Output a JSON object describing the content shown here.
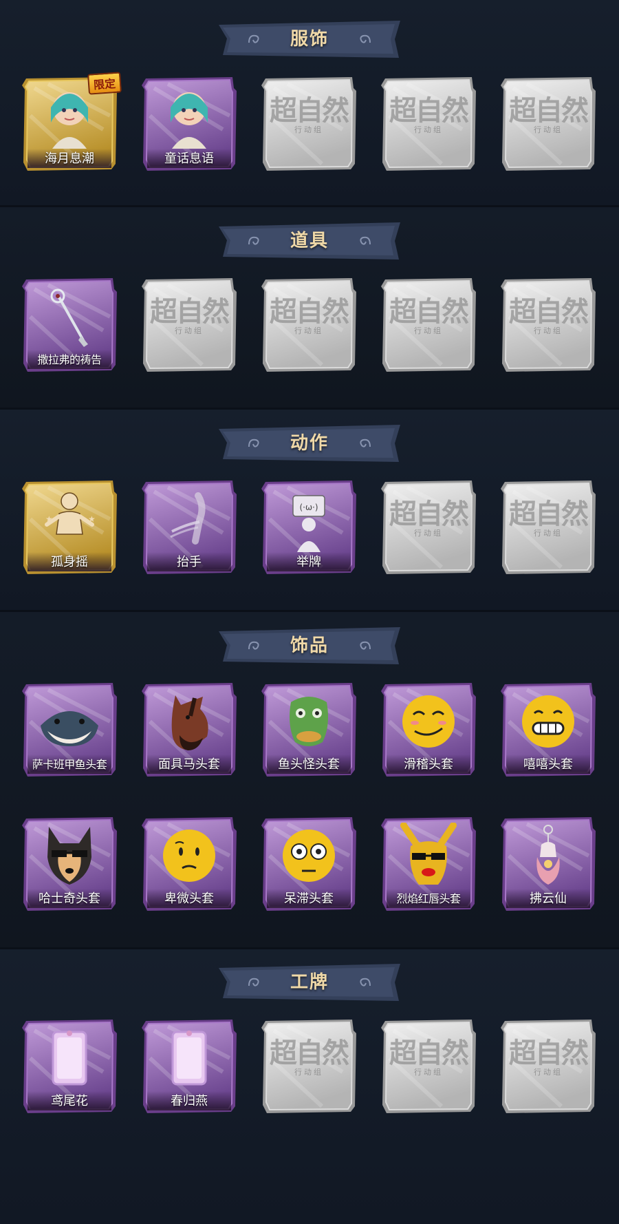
{
  "colors": {
    "background": "#121a26",
    "banner": "#3a4660",
    "title_text": "#f0d9a8",
    "purple_frame": "#8a5aa8",
    "gold_frame": "#d4b048",
    "silver_frame": "#c8c8c8"
  },
  "sections": [
    {
      "title": "服饰",
      "items": [
        {
          "label": "海月息潮",
          "rarity": "gold",
          "badge": "限定",
          "icon": "character-portrait-icon"
        },
        {
          "label": "童话息语",
          "rarity": "purple",
          "icon": "character-portrait-icon"
        },
        {
          "label": "",
          "rarity": "locked",
          "ghost": "超自然",
          "ghost_sub": "行动组"
        },
        {
          "label": "",
          "rarity": "locked",
          "ghost": "超自然",
          "ghost_sub": "行动组"
        },
        {
          "label": "",
          "rarity": "locked",
          "ghost": "超自然",
          "ghost_sub": "行动组"
        }
      ]
    },
    {
      "title": "道具",
      "items": [
        {
          "label": "撒拉弗的祷告",
          "rarity": "purple",
          "icon": "staff-icon"
        },
        {
          "label": "",
          "rarity": "locked",
          "ghost": "超自然",
          "ghost_sub": "行动组"
        },
        {
          "label": "",
          "rarity": "locked",
          "ghost": "超自然",
          "ghost_sub": "行动组"
        },
        {
          "label": "",
          "rarity": "locked",
          "ghost": "超自然",
          "ghost_sub": "行动组"
        },
        {
          "label": "",
          "rarity": "locked",
          "ghost": "超自然",
          "ghost_sub": "行动组"
        }
      ]
    },
    {
      "title": "动作",
      "items": [
        {
          "label": "孤身摇",
          "rarity": "gold",
          "icon": "dance-pose-icon"
        },
        {
          "label": "抬手",
          "rarity": "purple",
          "icon": "raise-hand-icon"
        },
        {
          "label": "举牌",
          "rarity": "purple",
          "icon": "hold-sign-icon"
        },
        {
          "label": "",
          "rarity": "locked",
          "ghost": "超自然",
          "ghost_sub": "行动组"
        },
        {
          "label": "",
          "rarity": "locked",
          "ghost": "超自然",
          "ghost_sub": "行动组"
        }
      ]
    },
    {
      "title": "饰品",
      "items": [
        {
          "label": "萨卡班甲鱼头套",
          "rarity": "purple",
          "icon": "fish-head-icon"
        },
        {
          "label": "面具马头套",
          "rarity": "purple",
          "icon": "horse-mask-icon"
        },
        {
          "label": "鱼头怪头套",
          "rarity": "purple",
          "icon": "fishman-mask-icon"
        },
        {
          "label": "滑稽头套",
          "rarity": "purple",
          "icon": "funny-face-icon"
        },
        {
          "label": "嘻嘻头套",
          "rarity": "purple",
          "icon": "grin-face-icon"
        },
        {
          "label": "哈士奇头套",
          "rarity": "purple",
          "icon": "husky-mask-icon"
        },
        {
          "label": "卑微头套",
          "rarity": "purple",
          "icon": "humble-face-icon"
        },
        {
          "label": "呆滞头套",
          "rarity": "purple",
          "icon": "dazed-face-icon"
        },
        {
          "label": "烈焰红唇头套",
          "rarity": "purple",
          "icon": "pikachu-mask-icon"
        },
        {
          "label": "拂云仙",
          "rarity": "purple",
          "icon": "pendant-charm-icon"
        }
      ]
    },
    {
      "title": "工牌",
      "items": [
        {
          "label": "鸢尾花",
          "rarity": "purple",
          "icon": "badge-card-icon"
        },
        {
          "label": "春归燕",
          "rarity": "purple",
          "icon": "badge-card-icon"
        },
        {
          "label": "",
          "rarity": "locked",
          "ghost": "超自然",
          "ghost_sub": "行动组"
        },
        {
          "label": "",
          "rarity": "locked",
          "ghost": "超自然",
          "ghost_sub": "行动组"
        },
        {
          "label": "",
          "rarity": "locked",
          "ghost": "超自然",
          "ghost_sub": "行动组"
        }
      ]
    }
  ]
}
